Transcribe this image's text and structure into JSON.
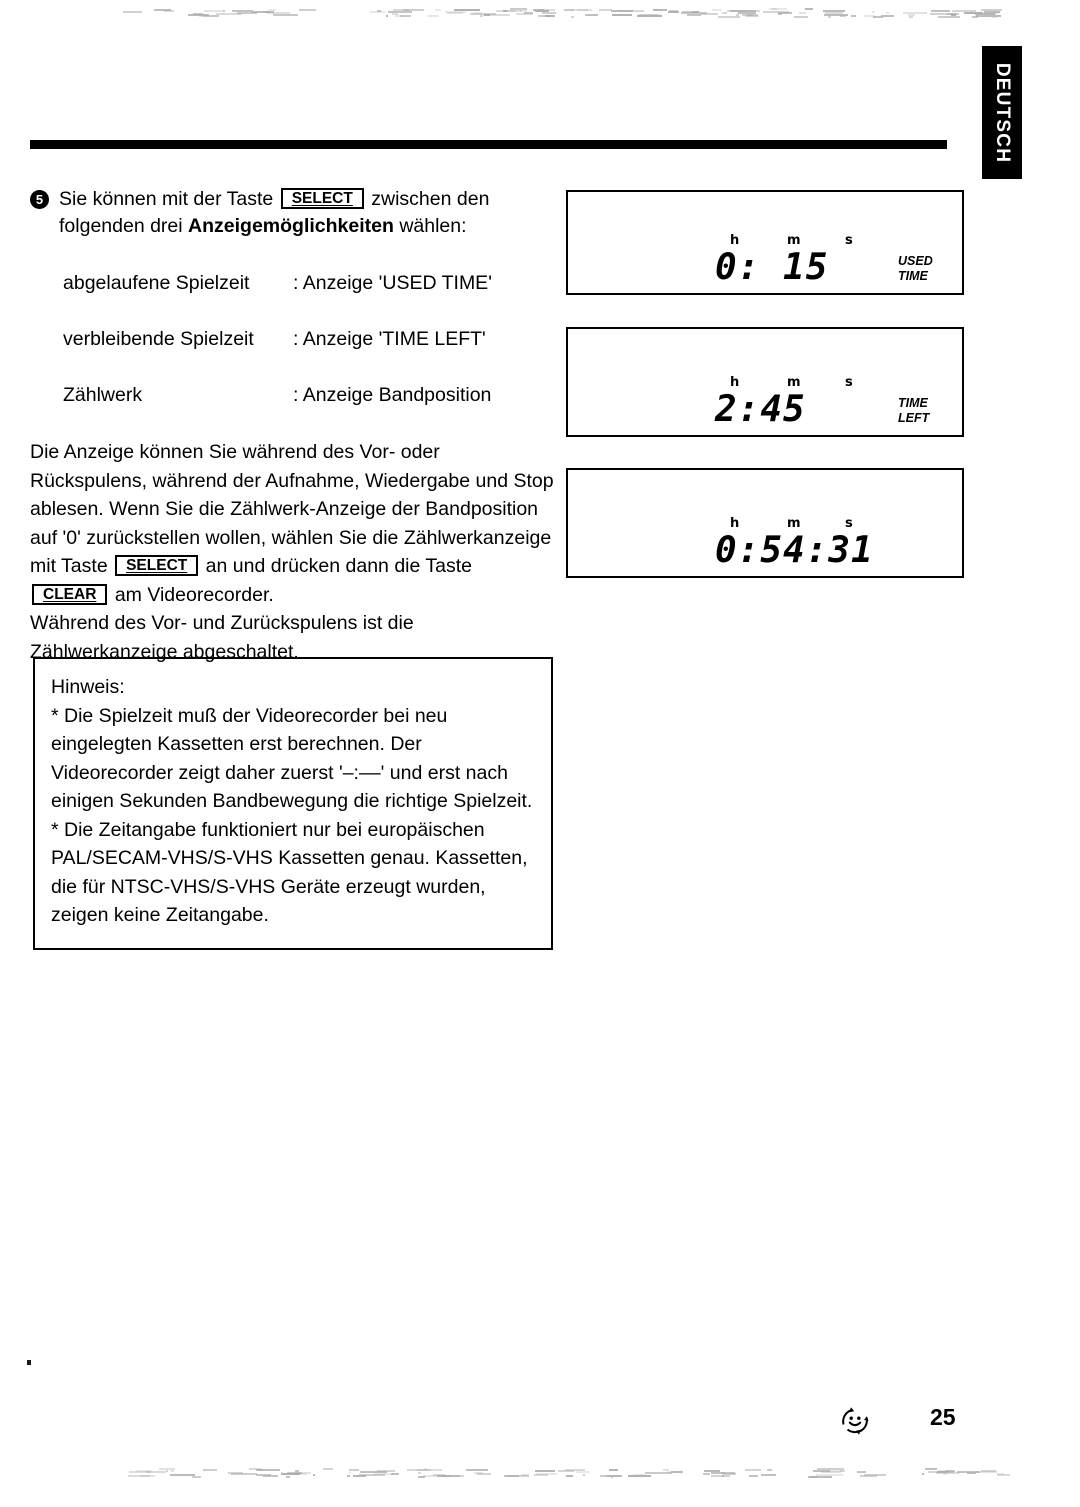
{
  "page": {
    "language_tab": "DEUTSCH",
    "page_number": "25",
    "footer_icon": "smiley-recycle-icon"
  },
  "step": {
    "number": "5",
    "text_before_key": "Sie können mit der Taste",
    "key_label": "SELECT",
    "text_after_key": "zwischen den folgenden drei",
    "bold_term": "Anzeigemöglichkeiten",
    "text_end": "wählen:"
  },
  "definitions": [
    {
      "term": "abgelaufene Spielzeit",
      "description": ": Anzeige 'USED TIME'"
    },
    {
      "term": "verbleibende Spielzeit",
      "description": ": Anzeige  'TIME LEFT'"
    },
    {
      "term": "Zählwerk",
      "description": ": Anzeige Bandposition"
    }
  ],
  "body": {
    "part1": "Die Anzeige können Sie während des Vor- oder Rückspulens, während der Aufnahme, Wiedergabe und Stop ablesen. Wenn Sie die Zählwerk-Anzeige der Bandposition auf '0' zurückstellen wollen, wählen Sie die Zählwerkanzeige mit Taste",
    "key_select": "SELECT",
    "part2": "an und drücken dann die Taste",
    "key_clear": "CLEAR",
    "part3": "am Videorecorder.",
    "part4": "Während des Vor- und Zurückspulens ist die Zählwerkanzeige abgeschaltet."
  },
  "note": {
    "heading": "Hinweis:",
    "items": [
      "* Die Spielzeit muß der Videorecorder bei neu eingelegten Kassetten erst berechnen. Der Videorecorder zeigt daher zuerst '–:––' und erst nach einigen Sekunden Bandbewegung die richtige Spielzeit.",
      "* Die Zeitangabe funktioniert nur bei europäischen PAL/SECAM-VHS/S-VHS Kassetten genau. Kassetten, die für NTSC-VHS/S-VHS Geräte erzeugt wurden, zeigen keine Zeitangabe."
    ]
  },
  "displays": [
    {
      "name": "used-time-display",
      "unit_h": "h",
      "unit_m": "m",
      "unit_s": "s",
      "value": "0: 15",
      "mode_label": "USED\nTIME"
    },
    {
      "name": "time-left-display",
      "unit_h": "h",
      "unit_m": "m",
      "unit_s": "s",
      "value": "2:45",
      "mode_label": "TIME\nLEFT"
    },
    {
      "name": "tape-counter-display",
      "unit_h": "h",
      "unit_m": "m",
      "unit_s": "s",
      "value": "0:54:31",
      "mode_label": ""
    }
  ]
}
